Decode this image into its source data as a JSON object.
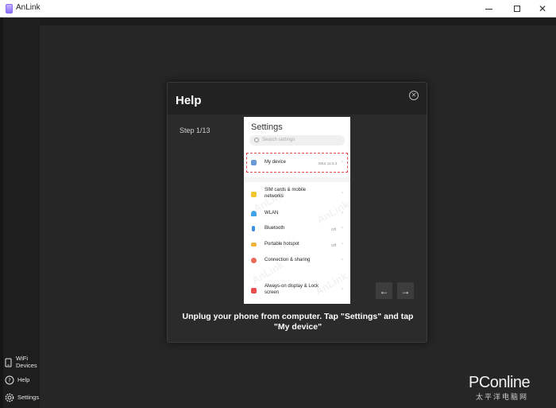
{
  "window": {
    "title": "AnLink",
    "min_glyph": "—",
    "max_glyph": "☐",
    "close_glyph": "✕"
  },
  "sidebar": {
    "items": [
      {
        "label": "WiFi Devices",
        "icon": "phone-icon"
      },
      {
        "label": "Help",
        "icon": "help-icon"
      },
      {
        "label": "Settings",
        "icon": "gear-icon"
      }
    ]
  },
  "dialog": {
    "title": "Help",
    "close_glyph": "✕",
    "step": "Step 1/13",
    "instruction": "Unplug your phone from computer. Tap \"Settings\" and tap \"My device\"",
    "prev_glyph": "←",
    "next_glyph": "→"
  },
  "phone": {
    "title": "Settings",
    "search_placeholder": "Search settings",
    "watermark": "AnLink",
    "rows": [
      {
        "label": "My device",
        "value": "MIUI 12.5.3",
        "icon_color": "#6c9ad8"
      },
      {
        "label": "SIM cards & mobile networks",
        "value": "",
        "icon_color": "#f2c531"
      },
      {
        "label": "WLAN",
        "value": "",
        "icon_color": "#3fa3e8"
      },
      {
        "label": "Bluetooth",
        "value": "Off",
        "icon_color": "#3c8ee0"
      },
      {
        "label": "Portable hotspot",
        "value": "Off",
        "icon_color": "#f3b13a"
      },
      {
        "label": "Connection & sharing",
        "value": "",
        "icon_color": "#e86a5a"
      },
      {
        "label": "Always-on display & Lock screen",
        "value": "",
        "icon_color": "#e84c4c"
      }
    ]
  },
  "brand": {
    "name": "PConline",
    "sub": "太平洋电脑网"
  },
  "colors": {
    "background": "#1c1c1c",
    "dialog": "#2b2b2b",
    "highlight": "#e24a4a",
    "accent": "#8b6cf0"
  }
}
